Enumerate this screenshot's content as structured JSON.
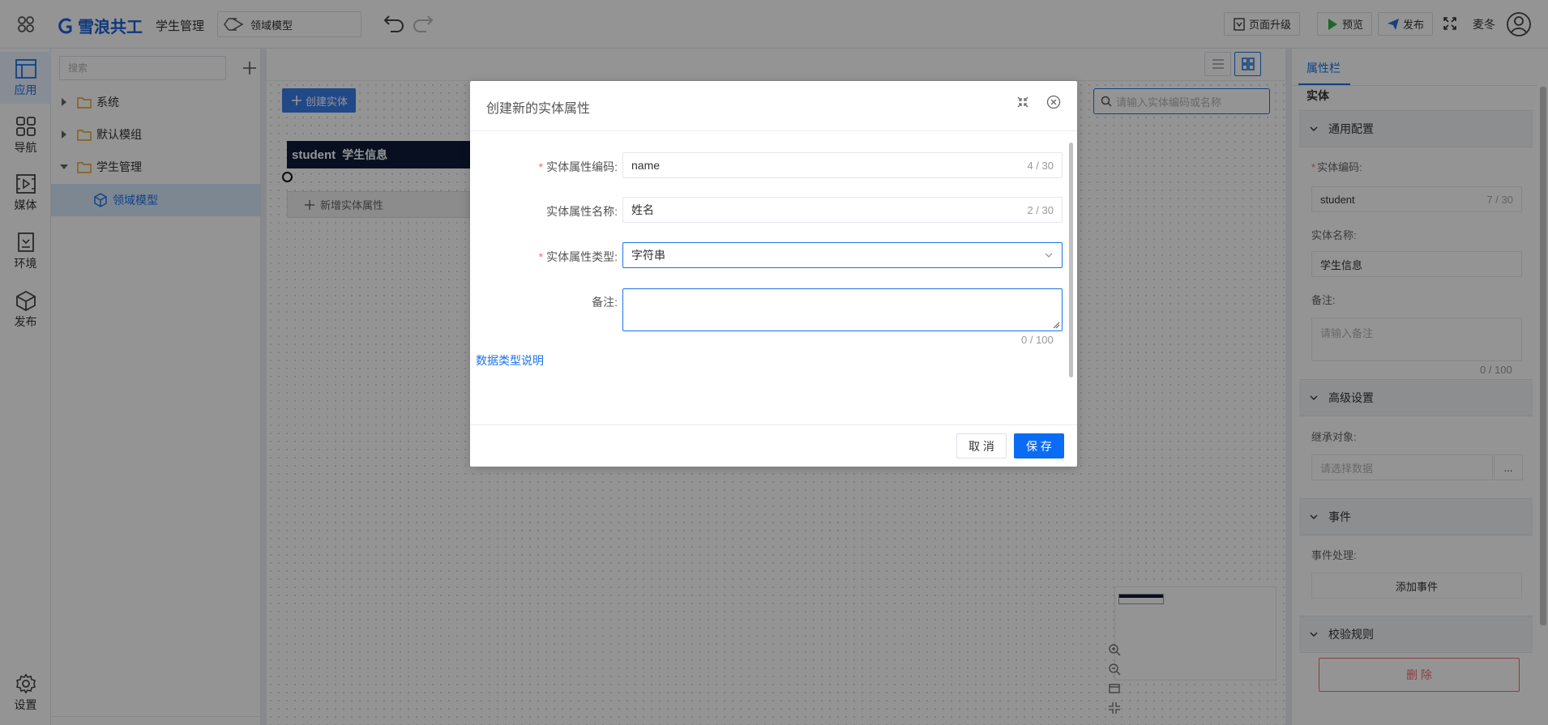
{
  "header": {
    "brand": "雪浪共工",
    "app_name": "学生管理",
    "page_select": "领域模型",
    "upgrade": "页面升级",
    "preview": "预览",
    "publish": "发布",
    "user": "麦冬"
  },
  "rail": {
    "items": [
      {
        "label": "应用"
      },
      {
        "label": "导航"
      },
      {
        "label": "媒体"
      },
      {
        "label": "环境"
      },
      {
        "label": "发布"
      }
    ],
    "settings": "设置"
  },
  "tree": {
    "search_placeholder": "搜索",
    "nodes": [
      {
        "label": "系统"
      },
      {
        "label": "默认模组"
      },
      {
        "label": "学生管理"
      },
      {
        "label": "领域模型"
      }
    ]
  },
  "canvas": {
    "create_entity": "创建实体",
    "search_placeholder": "请输入实体编码或名称",
    "entity": {
      "code": "student",
      "name": "学生信息",
      "add_attr": "新增实体属性"
    }
  },
  "props": {
    "tab": "属性栏",
    "title": "实体",
    "general": {
      "heading": "通用配置",
      "code_label": "实体编码:",
      "code_value": "student",
      "code_count": "7 / 30",
      "name_label": "实体名称:",
      "name_value": "学生信息",
      "remark_label": "备注:",
      "remark_placeholder": "请输入备注",
      "remark_count": "0 / 100"
    },
    "advanced": {
      "heading": "高级设置",
      "inherit_label": "继承对象:",
      "inherit_placeholder": "请选择数据",
      "more": "..."
    },
    "events": {
      "heading": "事件",
      "handler_label": "事件处理:",
      "add_event": "添加事件"
    },
    "validation": {
      "heading": "校验规则"
    },
    "delete": "删 除"
  },
  "dialog": {
    "title": "创建新的实体属性",
    "fields": {
      "code_label": "实体属性编码:",
      "code_value": "name",
      "code_count": "4 / 30",
      "name_label": "实体属性名称:",
      "name_value": "姓名",
      "name_count": "2 / 30",
      "type_label": "实体属性类型:",
      "type_value": "字符串",
      "remark_label": "备注:",
      "remark_count": "0 / 100"
    },
    "type_help": "数据类型说明",
    "cancel": "取 消",
    "save": "保 存"
  },
  "colors": {
    "accent": "#1a73e8",
    "danger": "#f56c6c",
    "entity_header": "#0d1b3a"
  }
}
